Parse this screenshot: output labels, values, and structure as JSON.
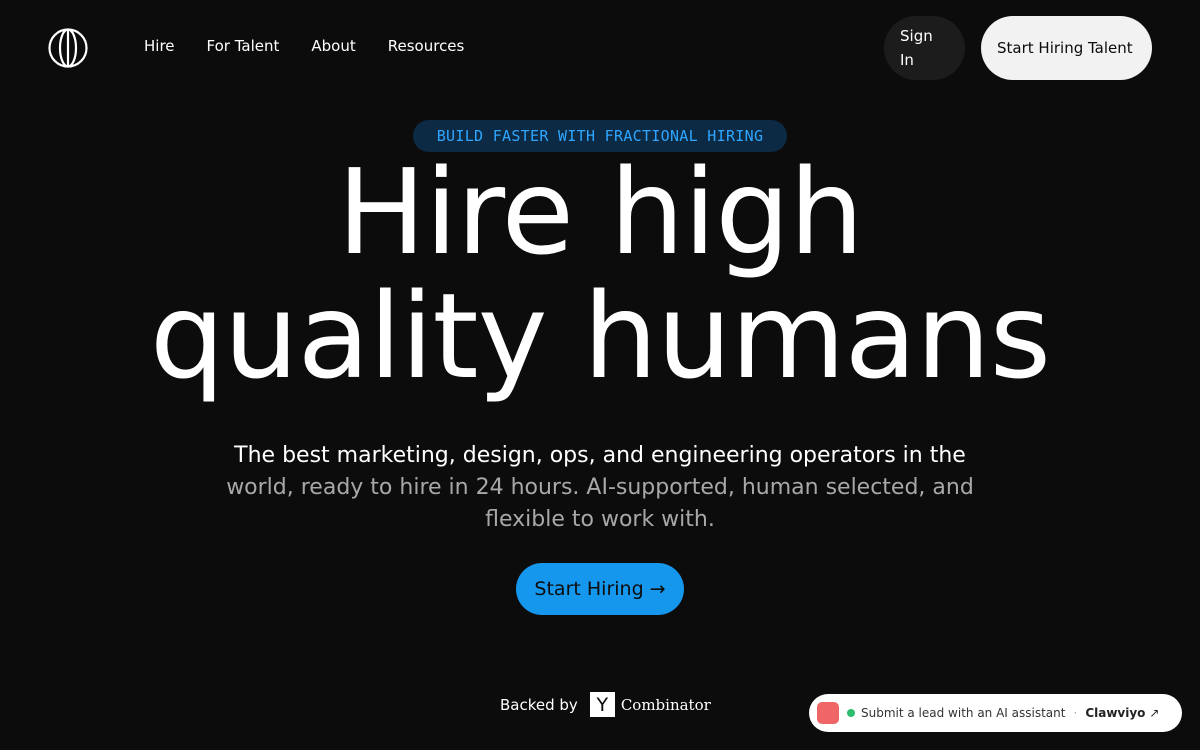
{
  "header": {
    "logo_icon": "globe-lines-icon",
    "nav": [
      {
        "label": "Hire"
      },
      {
        "label": "For Talent"
      },
      {
        "label": "About"
      },
      {
        "label": "Resources"
      }
    ],
    "sign_in_label": "Sign In",
    "start_hiring_talent_label": "Start Hiring Talent"
  },
  "hero": {
    "badge": "BUILD FASTER WITH FRACTIONAL HIRING",
    "headline_line1": "Hire high",
    "headline_line2": "quality humans",
    "subtitle_part1": "The best marketing, design, ops, and engineering operators in the",
    "subtitle_part2": "world, ready to hire in 24 hours. AI-supported, human selected, and flexible to work with.",
    "cta_label": "Start Hiring",
    "cta_arrow": "→"
  },
  "backed": {
    "label": "Backed by",
    "yc_letter": "Y",
    "yc_word": "Combinator"
  },
  "widget": {
    "text": "Submit a lead with an AI assistant",
    "separator": "·",
    "brand": "Clawviyo",
    "arrow": "↗"
  },
  "colors": {
    "background": "#0c0c0c",
    "accent": "#1697ee",
    "badge_text": "#2ea6ff",
    "badge_bg": "#0d2a45"
  }
}
